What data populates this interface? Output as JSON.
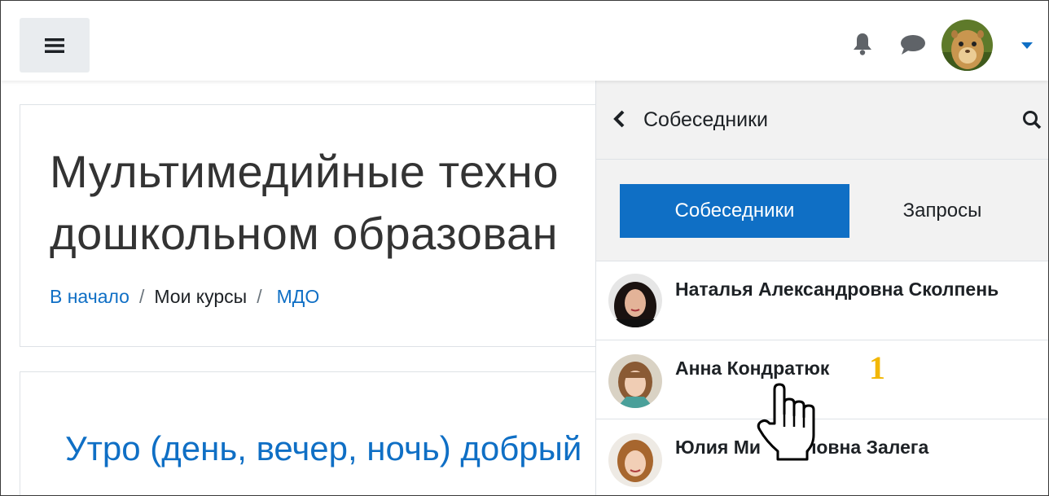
{
  "header": {
    "menu_icon": "hamburger-icon",
    "notification_icon": "bell-icon",
    "messages_icon": "chat-bubble-icon",
    "user_menu_icon": "caret-down-icon",
    "accent": "#0f6fc5"
  },
  "course": {
    "title_line1": "Мультимедийные техно",
    "title_line2": "дошкольном образован",
    "breadcrumb": [
      {
        "label": "В начало"
      },
      {
        "label": "Мои курсы"
      },
      {
        "label": "МДО"
      }
    ],
    "separator": "/"
  },
  "section": {
    "greeting": "Утро (день, вечер, ночь) добрый"
  },
  "drawer": {
    "title": "Собеседники",
    "tabs": [
      {
        "label": "Собеседники",
        "active": true
      },
      {
        "label": "Запросы",
        "active": false
      }
    ],
    "contacts": [
      {
        "name": "Наталья Александровна Сколпень"
      },
      {
        "name": "Анна Кондратюк"
      },
      {
        "name": "Юлия Ми",
        "name_tail": "ловна Залега"
      }
    ]
  },
  "annotation": {
    "step": "1",
    "color": "#f2b705"
  }
}
